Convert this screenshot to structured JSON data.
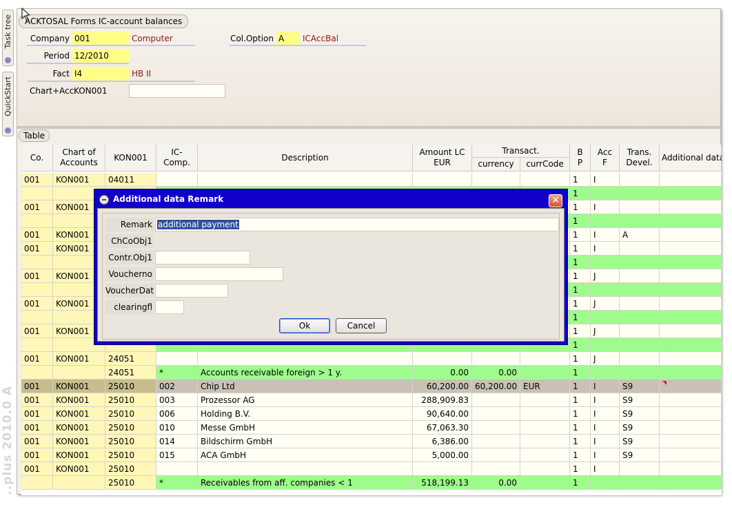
{
  "sidebar": {
    "tab1": "Task tree",
    "tab2": "QuickStart",
    "watermark": "..plus 2010.0 A"
  },
  "window": {
    "title": "ACKTOSAL Forms IC-account balances"
  },
  "form": {
    "company_label": "Company",
    "company_value": "001",
    "company_desc": "Computer",
    "period_label": "Period",
    "period_value": "12/2010",
    "fact_label": "Fact",
    "fact_value": "I4",
    "fact_desc": "HB II",
    "chart_acc_label": "Chart+Acc.",
    "chart_acc_value": "KON001",
    "coloption_label": "Col.Option",
    "coloption_value": "A",
    "coloption_desc": "ICAccBal"
  },
  "table": {
    "tab_label": "Table",
    "headers": {
      "co": "Co.",
      "chart": "Chart of Accounts",
      "kon": "KON001",
      "ic": "IC-Comp.",
      "desc": "Description",
      "amount": "Amount LC EUR",
      "transact": "Transact.",
      "currency": "currency",
      "currcode": "currCode",
      "bp": "B P",
      "acc": "Acc F",
      "trans_devel": "Trans. Devel.",
      "additional": "Additional data"
    },
    "rows": [
      {
        "type": "w",
        "co": "001",
        "chart": "KON001",
        "kon": "04011",
        "ic": "",
        "desc": "",
        "amount": "",
        "cur": "",
        "code": "",
        "bp": "1",
        "acc": "I",
        "td": "",
        "add": ""
      },
      {
        "type": "g",
        "co": "",
        "chart": "",
        "kon": "",
        "ic": "",
        "desc": "",
        "amount": "",
        "cur": "",
        "code": "",
        "bp": "1",
        "acc": "",
        "td": "",
        "add": ""
      },
      {
        "type": "w",
        "co": "001",
        "chart": "KON001",
        "kon": "",
        "ic": "",
        "desc": "",
        "amount": "",
        "cur": "",
        "code": "",
        "bp": "1",
        "acc": "I",
        "td": "",
        "add": ""
      },
      {
        "type": "g",
        "co": "",
        "chart": "",
        "kon": "",
        "ic": "",
        "desc": "",
        "amount": "",
        "cur": "",
        "code": "",
        "bp": "1",
        "acc": "",
        "td": "",
        "add": ""
      },
      {
        "type": "w",
        "co": "001",
        "chart": "KON001",
        "kon": "",
        "ic": "",
        "desc": "",
        "amount": "",
        "cur": "",
        "code": "",
        "bp": "1",
        "acc": "I",
        "td": "A",
        "add": ""
      },
      {
        "type": "w",
        "co": "001",
        "chart": "KON001",
        "kon": "",
        "ic": "",
        "desc": "",
        "amount": "",
        "cur": "",
        "code": "",
        "bp": "1",
        "acc": "I",
        "td": "",
        "add": ""
      },
      {
        "type": "g",
        "co": "",
        "chart": "",
        "kon": "",
        "ic": "",
        "desc": "",
        "amount": "",
        "cur": "",
        "code": "",
        "bp": "1",
        "acc": "",
        "td": "",
        "add": ""
      },
      {
        "type": "w",
        "co": "001",
        "chart": "KON001",
        "kon": "",
        "ic": "",
        "desc": "",
        "amount": "",
        "cur": "",
        "code": "",
        "bp": "1",
        "acc": "J",
        "td": "",
        "add": ""
      },
      {
        "type": "g",
        "co": "",
        "chart": "",
        "kon": "",
        "ic": "",
        "desc": "",
        "amount": "",
        "cur": "",
        "code": "",
        "bp": "1",
        "acc": "",
        "td": "",
        "add": ""
      },
      {
        "type": "w",
        "co": "001",
        "chart": "KON001",
        "kon": "",
        "ic": "",
        "desc": "",
        "amount": "",
        "cur": "",
        "code": "",
        "bp": "1",
        "acc": "J",
        "td": "",
        "add": ""
      },
      {
        "type": "g",
        "co": "",
        "chart": "",
        "kon": "",
        "ic": "",
        "desc": "",
        "amount": "",
        "cur": "",
        "code": "",
        "bp": "1",
        "acc": "",
        "td": "",
        "add": ""
      },
      {
        "type": "w",
        "co": "001",
        "chart": "KON001",
        "kon": "",
        "ic": "",
        "desc": "",
        "amount": "",
        "cur": "",
        "code": "",
        "bp": "1",
        "acc": "J",
        "td": "",
        "add": ""
      },
      {
        "type": "g",
        "co": "",
        "chart": "",
        "kon": "",
        "ic": "",
        "desc": "",
        "amount": "",
        "cur": "",
        "code": "",
        "bp": "1",
        "acc": "",
        "td": "",
        "add": ""
      },
      {
        "type": "w",
        "co": "001",
        "chart": "KON001",
        "kon": "24051",
        "ic": "",
        "desc": "",
        "amount": "",
        "cur": "",
        "code": "",
        "bp": "1",
        "acc": "J",
        "td": "",
        "add": ""
      },
      {
        "type": "g",
        "co": "",
        "chart": "",
        "kon": "24051",
        "ic": "*",
        "desc": "Accounts receivable foreign > 1 y.",
        "amount": "0.00",
        "cur": "0.00",
        "code": "",
        "bp": "1",
        "acc": "",
        "td": "",
        "add": ""
      },
      {
        "type": "s",
        "co": "001",
        "chart": "KON001",
        "kon": "25010",
        "ic": "002",
        "desc": "Chip Ltd",
        "amount": "60,200.00",
        "cur": "60,200.00",
        "code": "EUR",
        "bp": "1",
        "acc": "I",
        "td": "S9",
        "add": "",
        "flag": true
      },
      {
        "type": "w",
        "co": "001",
        "chart": "KON001",
        "kon": "25010",
        "ic": "003",
        "desc": "Prozessor AG",
        "amount": "288,909.83",
        "cur": "",
        "code": "",
        "bp": "1",
        "acc": "I",
        "td": "S9",
        "add": ""
      },
      {
        "type": "w",
        "co": "001",
        "chart": "KON001",
        "kon": "25010",
        "ic": "006",
        "desc": "Holding B.V.",
        "amount": "90,640.00",
        "cur": "",
        "code": "",
        "bp": "1",
        "acc": "I",
        "td": "S9",
        "add": ""
      },
      {
        "type": "w",
        "co": "001",
        "chart": "KON001",
        "kon": "25010",
        "ic": "010",
        "desc": "Messe GmbH",
        "amount": "67,063.30",
        "cur": "",
        "code": "",
        "bp": "1",
        "acc": "I",
        "td": "S9",
        "add": ""
      },
      {
        "type": "w",
        "co": "001",
        "chart": "KON001",
        "kon": "25010",
        "ic": "014",
        "desc": "Bildschirm GmbH",
        "amount": "6,386.00",
        "cur": "",
        "code": "",
        "bp": "1",
        "acc": "I",
        "td": "S9",
        "add": ""
      },
      {
        "type": "w",
        "co": "001",
        "chart": "KON001",
        "kon": "25010",
        "ic": "015",
        "desc": "ACA GmbH",
        "amount": "5,000.00",
        "cur": "",
        "code": "",
        "bp": "1",
        "acc": "I",
        "td": "S9",
        "add": ""
      },
      {
        "type": "w",
        "co": "001",
        "chart": "KON001",
        "kon": "25010",
        "ic": "",
        "desc": "",
        "amount": "",
        "cur": "",
        "code": "",
        "bp": "1",
        "acc": "I",
        "td": "",
        "add": ""
      },
      {
        "type": "g",
        "co": "",
        "chart": "",
        "kon": "25010",
        "ic": "*",
        "desc": "Receivables from aff. companies < 1",
        "amount": "518,199.13",
        "cur": "0.00",
        "code": "",
        "bp": "1",
        "acc": "",
        "td": "",
        "add": ""
      }
    ]
  },
  "dialog": {
    "title": "Additional data Remark",
    "close": "✕",
    "remark_label": "Remark",
    "remark_value": "additional payment",
    "chcoobj_label": "ChCoObj1",
    "contr_label": "Contr.Obj1",
    "voucherno_label": "Voucherno",
    "voucherdat_label": "VoucherDat",
    "clearing_label": "clearingfl",
    "ok_label": "Ok",
    "cancel_label": "Cancel"
  }
}
